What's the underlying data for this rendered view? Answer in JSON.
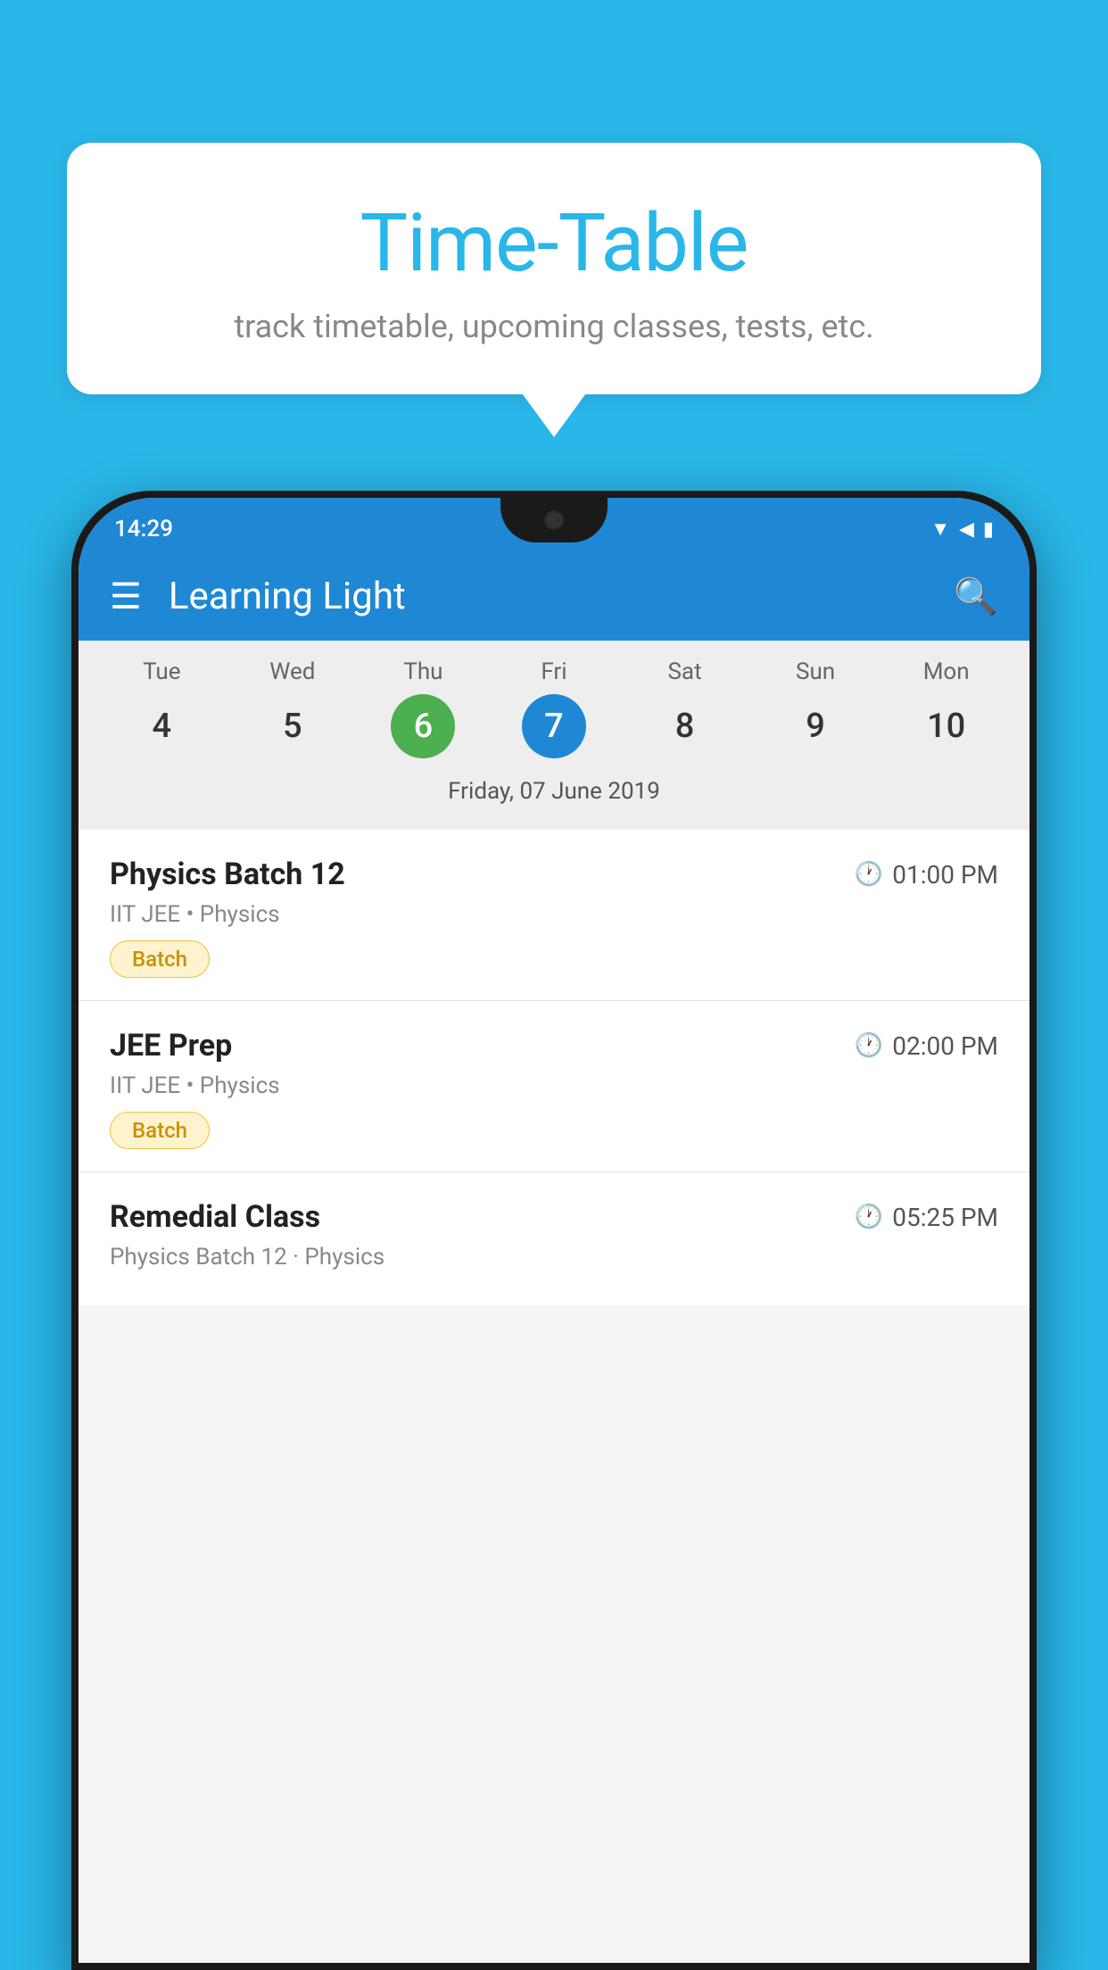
{
  "background_color": "#29b6e8",
  "bubble": {
    "title": "Time-Table",
    "subtitle": "track timetable, upcoming classes, tests, etc."
  },
  "status_bar": {
    "time": "14:29"
  },
  "app_bar": {
    "title": "Learning Light"
  },
  "calendar": {
    "days": [
      {
        "name": "Tue",
        "number": "4",
        "state": "normal"
      },
      {
        "name": "Wed",
        "number": "5",
        "state": "normal"
      },
      {
        "name": "Thu",
        "number": "6",
        "state": "today"
      },
      {
        "name": "Fri",
        "number": "7",
        "state": "selected"
      },
      {
        "name": "Sat",
        "number": "8",
        "state": "normal"
      },
      {
        "name": "Sun",
        "number": "9",
        "state": "normal"
      },
      {
        "name": "Mon",
        "number": "10",
        "state": "normal"
      }
    ],
    "selected_date": "Friday, 07 June 2019"
  },
  "classes": [
    {
      "name": "Physics Batch 12",
      "time": "01:00 PM",
      "subtitle": "IIT JEE • Physics",
      "badge": "Batch"
    },
    {
      "name": "JEE Prep",
      "time": "02:00 PM",
      "subtitle": "IIT JEE • Physics",
      "badge": "Batch"
    },
    {
      "name": "Remedial Class",
      "time": "05:25 PM",
      "subtitle": "Physics Batch 12 · Physics",
      "badge": null
    }
  ]
}
